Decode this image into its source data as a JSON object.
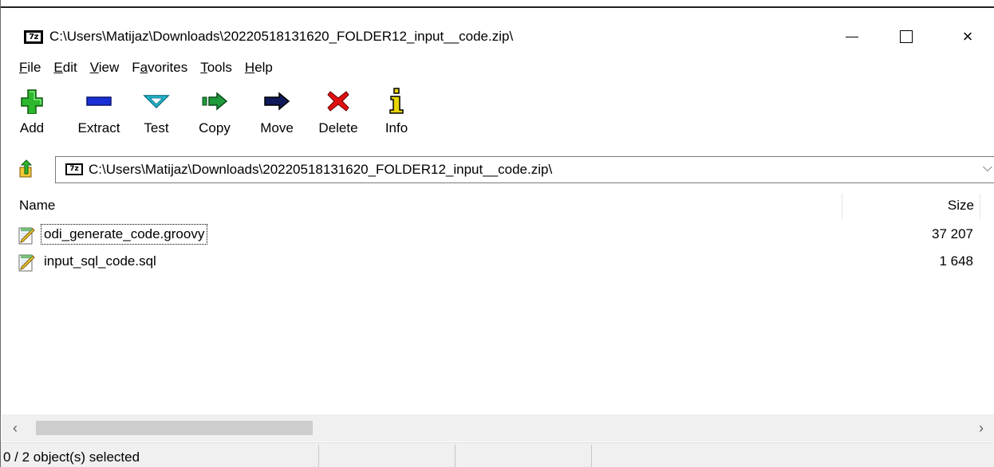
{
  "window": {
    "title": "C:\\Users\\Matijaz\\Downloads\\20220518131620_FOLDER12_input__code.zip\\",
    "app_icon_text": "7z",
    "controls": {
      "minimize": "minimize-icon",
      "maximize": "maximize-icon",
      "close": "×"
    }
  },
  "menu": {
    "items": [
      {
        "accel": "F",
        "rest": "ile"
      },
      {
        "accel": "E",
        "rest": "dit"
      },
      {
        "accel": "V",
        "rest": "iew"
      },
      {
        "pre": "F",
        "accel": "a",
        "rest": "vorites"
      },
      {
        "accel": "T",
        "rest": "ools"
      },
      {
        "accel": "H",
        "rest": "elp"
      }
    ]
  },
  "toolbar": {
    "buttons": [
      {
        "label": "Add",
        "icon": "plus-icon",
        "color": "#2db82d"
      },
      {
        "label": "Extract",
        "icon": "minus-icon",
        "color": "#1a2fd6"
      },
      {
        "label": "Test",
        "icon": "test-chevron-icon",
        "color": "#29c6e0"
      },
      {
        "label": "Copy",
        "icon": "copy-arrow-icon",
        "color": "#1f9a3a"
      },
      {
        "label": "Move",
        "icon": "move-arrow-icon",
        "color": "#10195a"
      },
      {
        "label": "Delete",
        "icon": "delete-x-icon",
        "color": "#e01010"
      },
      {
        "label": "Info",
        "icon": "info-icon",
        "color": "#e8d400"
      }
    ]
  },
  "address": {
    "path": "C:\\Users\\Matijaz\\Downloads\\20220518131620_FOLDER12_input__code.zip\\",
    "icon_text": "7z",
    "dropdown": "⌵"
  },
  "list": {
    "columns": {
      "name": "Name",
      "size": "Size"
    },
    "rows": [
      {
        "name": "odi_generate_code.groovy",
        "size": "37 207"
      },
      {
        "name": "input_sql_code.sql",
        "size": "1 648"
      }
    ]
  },
  "scrollbar": {
    "left": "‹",
    "right": "›"
  },
  "status": {
    "text": "0 / 2 object(s) selected"
  }
}
